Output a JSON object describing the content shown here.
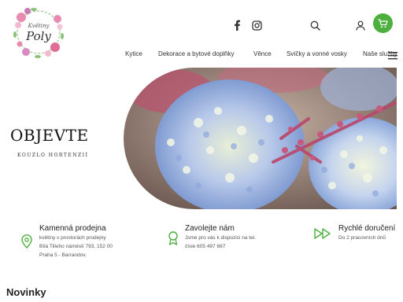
{
  "brand": {
    "logo_line1": "Květiny",
    "logo_line2": "Poly"
  },
  "header": {
    "icons": [
      "facebook-icon",
      "instagram-icon",
      "search-icon",
      "user-icon",
      "cart-icon"
    ],
    "accent_color": "#4caf3e"
  },
  "nav": {
    "items": [
      {
        "label": "Kytice"
      },
      {
        "label": "Dekorace a bytové doplňky"
      },
      {
        "label": "Věnce"
      },
      {
        "label": "Svíčky a vonné vosky"
      },
      {
        "label": "Naše služby"
      }
    ]
  },
  "hero": {
    "title": "OBJEVTE",
    "subtitle": "KOUZLO HORTENZIÍ"
  },
  "features": [
    {
      "title": "Kamenná prodejna",
      "lines": [
        "květiny v prostorách prodejny",
        "Bílá Tilleho náměstí 793, 152 00",
        "Praha 5 - Barrandov."
      ],
      "icon": "location-pin-icon"
    },
    {
      "title": "Zavolejte nám",
      "lines": [
        "Jsme pro vás k dispozici na tel.",
        "čísle 605 497 667"
      ],
      "icon": "award-icon"
    },
    {
      "title": "Rychlé doručení",
      "lines": [
        "Do 2 pracovních dnů"
      ],
      "icon": "fast-forward-icon"
    }
  ],
  "sections": {
    "news_heading": "Novinky"
  }
}
